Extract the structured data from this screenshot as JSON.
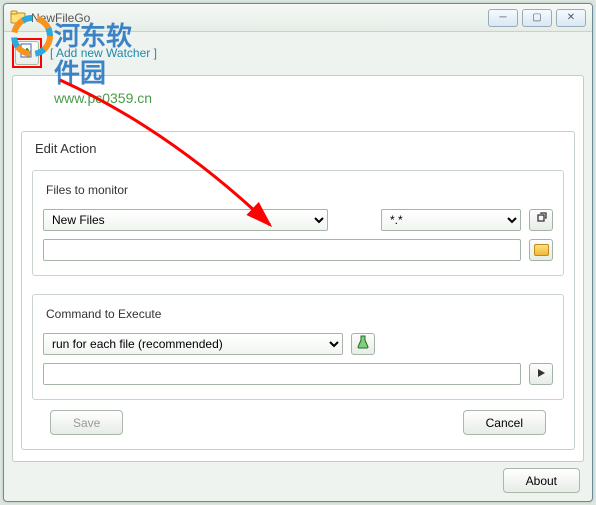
{
  "window": {
    "title": "NewFileGo"
  },
  "topbar": {
    "addLabel": "[ Add new Watcher ]"
  },
  "edit": {
    "title": "Edit Action",
    "filesTitle": "Files to monitor",
    "monitorOption": "New Files",
    "filterOption": "*.*",
    "cmdTitle": "Command to Execute",
    "cmdOption": "run for each file  (recommended)",
    "pathValue": "",
    "cmdValue": ""
  },
  "buttons": {
    "save": "Save",
    "cancel": "Cancel",
    "about": "About"
  },
  "watermark": {
    "main": "河东软件园",
    "url": "www.pc0359.cn"
  }
}
